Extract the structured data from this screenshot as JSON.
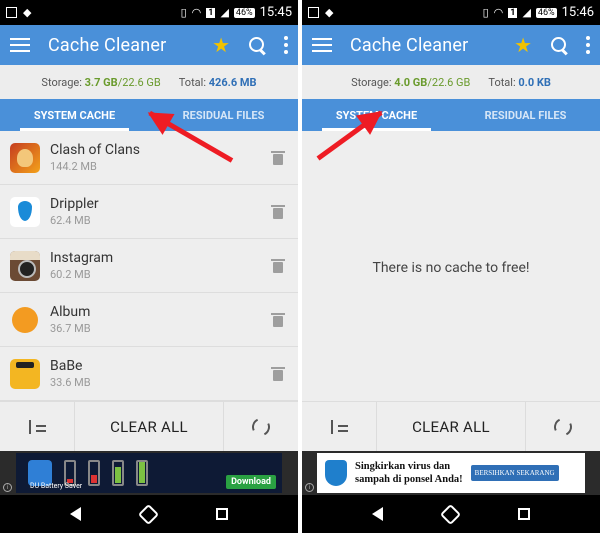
{
  "left": {
    "status": {
      "sim": "1",
      "battery": "46%",
      "time": "15:45"
    },
    "app_title": "Cache Cleaner",
    "storage": {
      "label": "Storage:",
      "used": "3.7 GB",
      "total_cap": "/22.6 GB",
      "total_label": "Total:",
      "total_value": "426.6 MB"
    },
    "tabs": [
      {
        "label": "SYSTEM CACHE"
      },
      {
        "label": "RESIDUAL FILES"
      }
    ],
    "items": [
      {
        "name": "Clash of Clans",
        "size": "144.2 MB",
        "icon": "clash-of-clans-icon"
      },
      {
        "name": "Drippler",
        "size": "62.4 MB",
        "icon": "drippler-icon"
      },
      {
        "name": "Instagram",
        "size": "60.2 MB",
        "icon": "instagram-icon"
      },
      {
        "name": "Album",
        "size": "36.7 MB",
        "icon": "album-icon"
      },
      {
        "name": "BaBe",
        "size": "33.6 MB",
        "icon": "babe-icon"
      }
    ],
    "clear_all": "CLEAR ALL",
    "ad": {
      "brand": "DU Battery Saver",
      "cta": "Download"
    }
  },
  "right": {
    "status": {
      "sim": "1",
      "battery": "46%",
      "time": "15:46"
    },
    "app_title": "Cache Cleaner",
    "storage": {
      "label": "Storage:",
      "used": "4.0 GB",
      "total_cap": "/22.6 GB",
      "total_label": "Total:",
      "total_value": "0.0 KB"
    },
    "tabs": [
      {
        "label": "SYSTEM CACHE"
      },
      {
        "label": "RESIDUAL FILES"
      }
    ],
    "empty_message": "There is no cache to free!",
    "clear_all": "CLEAR ALL",
    "ad": {
      "line1": "Singkirkan virus dan",
      "line2": "sampah di ponsel Anda!",
      "cta": "BERSIHKAN SEKARANG"
    }
  },
  "colors": {
    "app_bar": "#4a90d9",
    "annotation_arrow": "#ee1c24",
    "storage_used": "#6a9b2d",
    "total_value": "#2f6fb6"
  }
}
